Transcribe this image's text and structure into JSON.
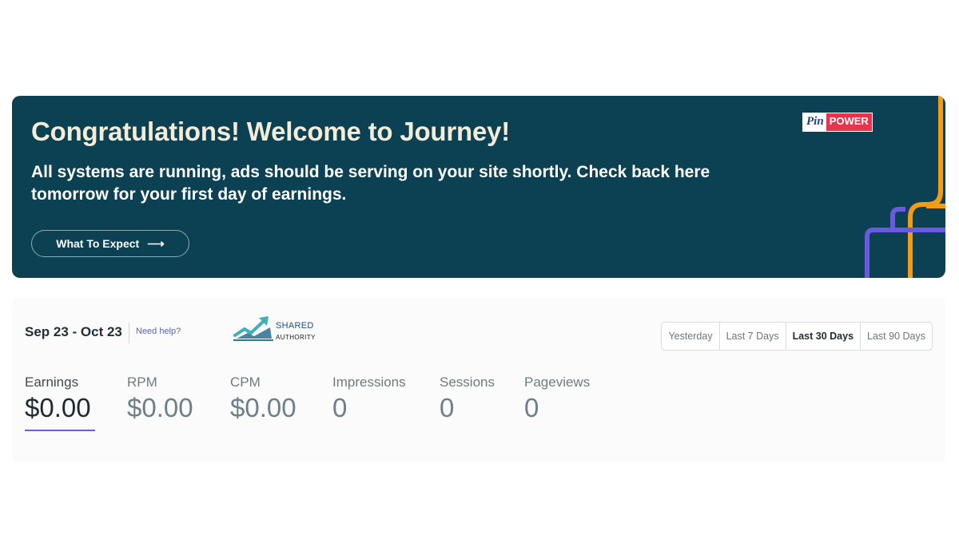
{
  "hero": {
    "title": "Congratulations! Welcome to Journey!",
    "text": "All systems are running, ads should be serving on your site shortly. Check back here tomorrow for your first day of earnings.",
    "button_label": "What To Expect",
    "button_icon": "arrow-right-icon",
    "background": "#0b4152",
    "deco_colors": [
      "#f39c12",
      "#6a5ae0"
    ]
  },
  "logo_pinpower": {
    "pin": "Pin",
    "power": "POWER"
  },
  "logo_shared": {
    "line1": "SHARED",
    "line2": "AUTHORITY"
  },
  "stats": {
    "range": "Sep 23 - Oct 23",
    "help": "Need help?",
    "tabs": [
      "Yesterday",
      "Last 7 Days",
      "Last 30 Days",
      "Last 90 Days"
    ],
    "active_tab": "Last 30 Days",
    "metrics": [
      {
        "label": "Earnings",
        "value": "$0.00"
      },
      {
        "label": "RPM",
        "value": "$0.00"
      },
      {
        "label": "CPM",
        "value": "$0.00"
      },
      {
        "label": "Impressions",
        "value": "0"
      },
      {
        "label": "Sessions",
        "value": "0"
      },
      {
        "label": "Pageviews",
        "value": "0"
      }
    ],
    "active_metric": "Earnings",
    "accent": "#6f5cd8"
  }
}
